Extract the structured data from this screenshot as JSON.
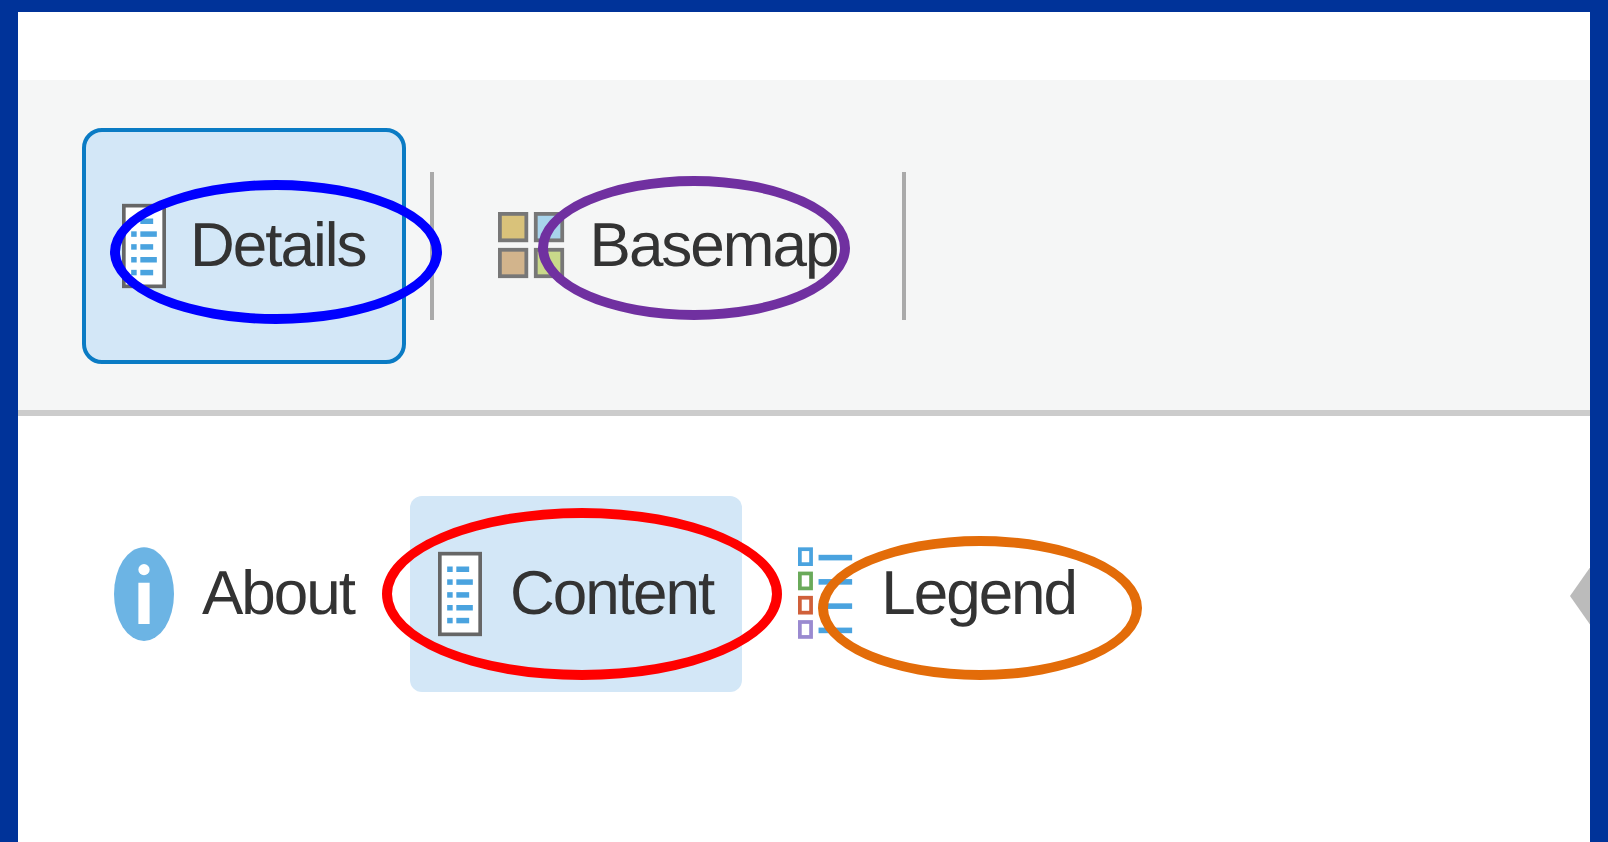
{
  "toolbar": {
    "buttons": [
      {
        "label": "Details",
        "selected": true,
        "kind": "details",
        "color": "#0000ff"
      },
      {
        "label": "Basemap",
        "selected": false,
        "kind": "basemap",
        "color": "#7030a0"
      }
    ]
  },
  "tabs": [
    {
      "label": "About",
      "selected": false,
      "kind": "about"
    },
    {
      "label": "Content",
      "selected": true,
      "kind": "content",
      "color": "#ff0000"
    },
    {
      "label": "Legend",
      "selected": false,
      "kind": "legend",
      "color": "#e36c09"
    }
  ]
}
